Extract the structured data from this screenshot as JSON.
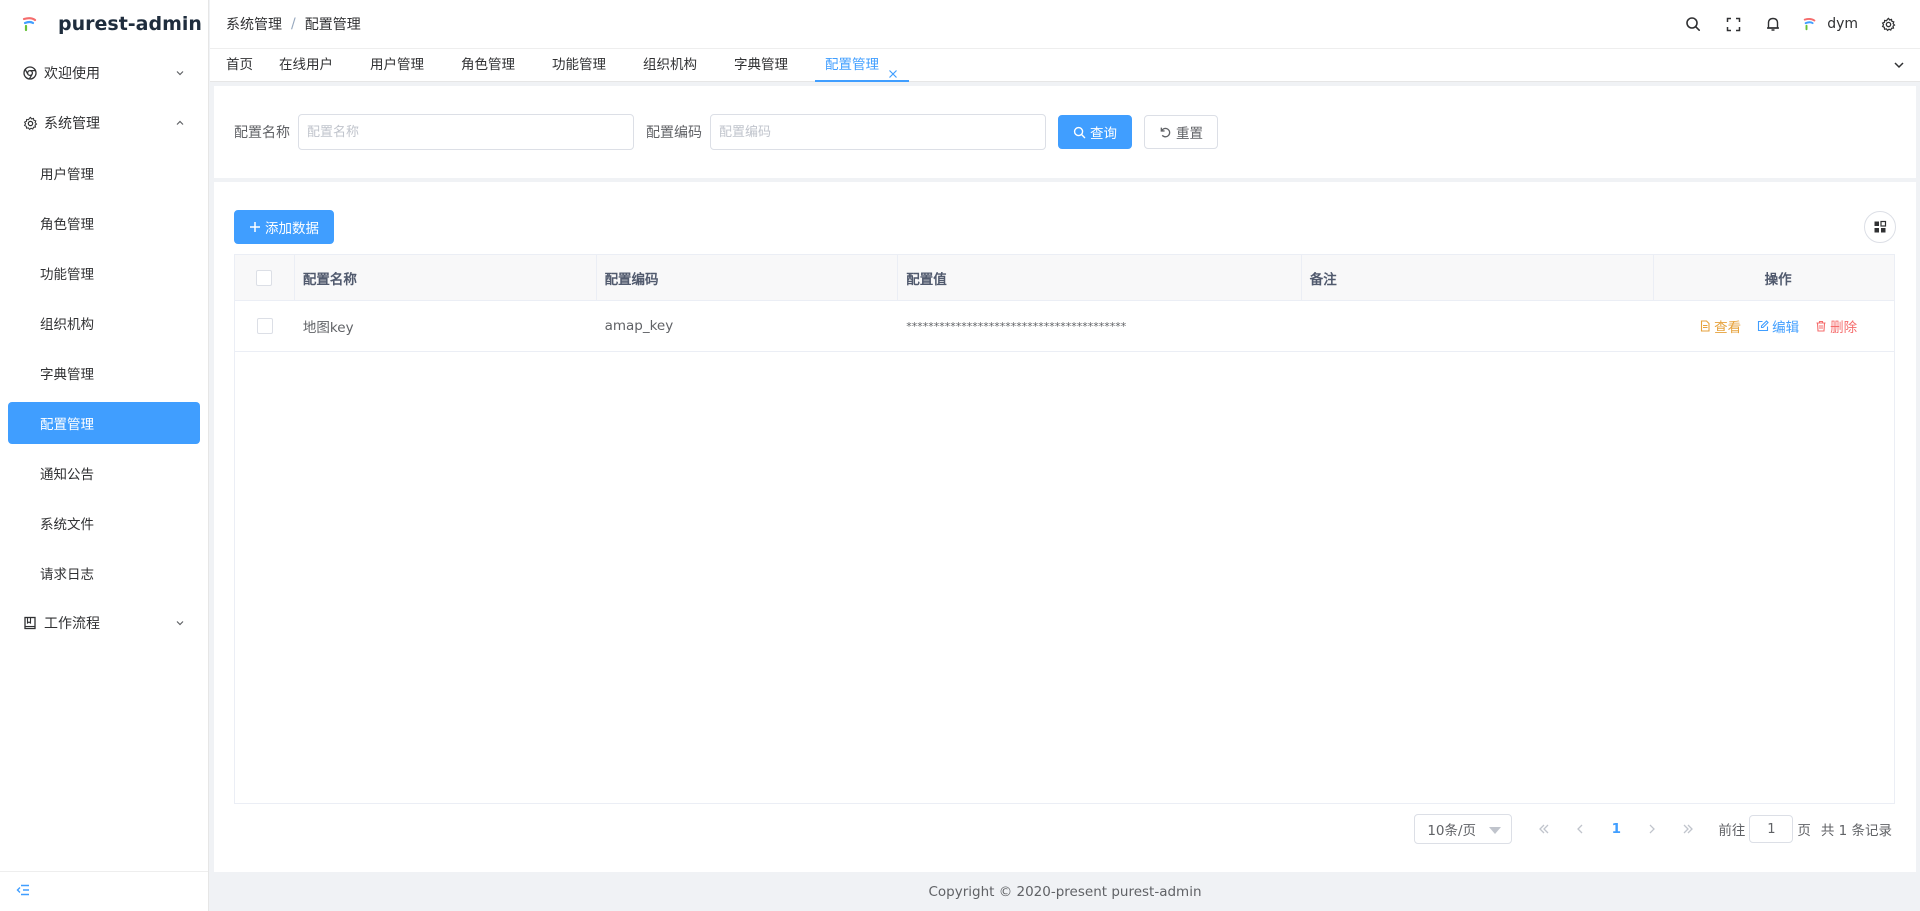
{
  "app": {
    "title": "purest-admin"
  },
  "sidebar": {
    "items": [
      {
        "label": "欢迎使用"
      },
      {
        "label": "系统管理"
      },
      {
        "label": "工作流程"
      }
    ],
    "sub_items": [
      {
        "label": "用户管理"
      },
      {
        "label": "角色管理"
      },
      {
        "label": "功能管理"
      },
      {
        "label": "组织机构"
      },
      {
        "label": "字典管理"
      },
      {
        "label": "配置管理"
      },
      {
        "label": "通知公告"
      },
      {
        "label": "系统文件"
      },
      {
        "label": "请求日志"
      }
    ]
  },
  "header": {
    "breadcrumb": [
      "系统管理",
      "配置管理"
    ],
    "user": "dym"
  },
  "tabs": [
    {
      "label": "首页"
    },
    {
      "label": "在线用户"
    },
    {
      "label": "用户管理"
    },
    {
      "label": "角色管理"
    },
    {
      "label": "功能管理"
    },
    {
      "label": "组织机构"
    },
    {
      "label": "字典管理"
    },
    {
      "label": "配置管理"
    }
  ],
  "search": {
    "name_label": "配置名称",
    "name_placeholder": "配置名称",
    "code_label": "配置编码",
    "code_placeholder": "配置编码",
    "query_label": "查询",
    "reset_label": "重置"
  },
  "table": {
    "add_label": "添加数据",
    "columns": [
      "配置名称",
      "配置编码",
      "配置值",
      "备注",
      "操作"
    ],
    "rows": [
      {
        "name": "地图key",
        "code": "amap_key",
        "value": "****************************************",
        "remark": ""
      }
    ],
    "actions": {
      "view": "查看",
      "edit": "编辑",
      "delete": "删除"
    }
  },
  "pagination": {
    "page_size": "10条/页",
    "current": "1",
    "goto_prefix": "前往",
    "goto_value": "1",
    "goto_suffix": "页",
    "total": "共 1 条记录"
  },
  "footer": {
    "copyright": "Copyright © 2020-present purest-admin"
  },
  "colors": {
    "primary": "#409eff",
    "warning": "#e6a23c",
    "danger": "#f56c6c"
  }
}
